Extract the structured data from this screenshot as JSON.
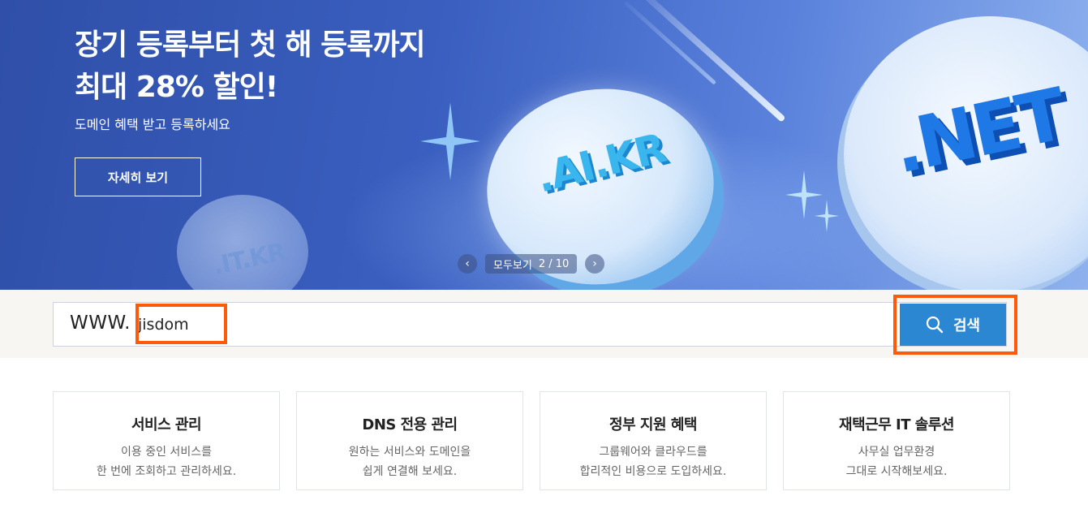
{
  "hero": {
    "headline_line1": "장기 등록부터 첫 해 등록까지",
    "headline_line2": "최대 28% 할인!",
    "subline": "도메인 혜택 받고 등록하세요",
    "detail_button": "자세히 보기",
    "coin_labels": [
      ".AI.KR",
      ".NET",
      ".IT.KR"
    ],
    "carousel": {
      "prev": "‹",
      "next": "›",
      "view_all": "모두보기",
      "counter": "2 / 10"
    }
  },
  "search": {
    "prefix": "WWW.",
    "value": "jisdom",
    "button_label": "검색"
  },
  "cards": [
    {
      "title": "서비스 관리",
      "desc1": "이용 중인 서비스를",
      "desc2": "한 번에 조회하고 관리하세요."
    },
    {
      "title": "DNS 전용 관리",
      "desc1": "원하는 서비스와 도메인을",
      "desc2": "쉽게 연결해 보세요."
    },
    {
      "title": "정부 지원 혜택",
      "desc1": "그룹웨어와 클라우드를",
      "desc2": "합리적인 비용으로 도입하세요."
    },
    {
      "title": "재택근무 IT 솔루션",
      "desc1": "사무실 업무환경",
      "desc2": "그대로 시작해보세요."
    }
  ],
  "colors": {
    "highlight": "#ff5a0a",
    "search_button": "#2b87d1"
  }
}
